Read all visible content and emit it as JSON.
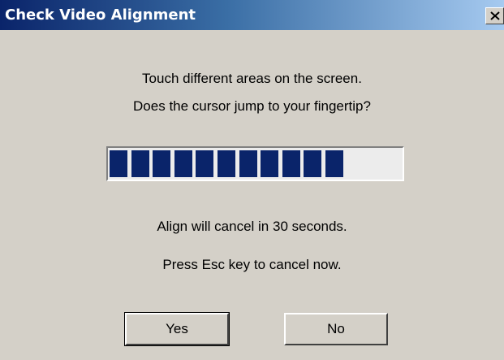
{
  "window": {
    "title": "Check Video Alignment",
    "close_label": "X"
  },
  "main": {
    "instruction_line1": "Touch different areas on the screen.",
    "instruction_line2": "Does the cursor jump to your fingertip?",
    "progress": {
      "filled_segments": 11,
      "total_segments": 14,
      "fill_color": "#0a246a"
    },
    "cancel_notice": "Align will cancel in 30 seconds.",
    "esc_notice": "Press Esc key to cancel now."
  },
  "buttons": {
    "yes_label": "Yes",
    "no_label": "No"
  },
  "colors": {
    "dialog_background": "#d4d0c8",
    "titlebar_start": "#0a246a",
    "titlebar_end": "#a6caf0"
  }
}
